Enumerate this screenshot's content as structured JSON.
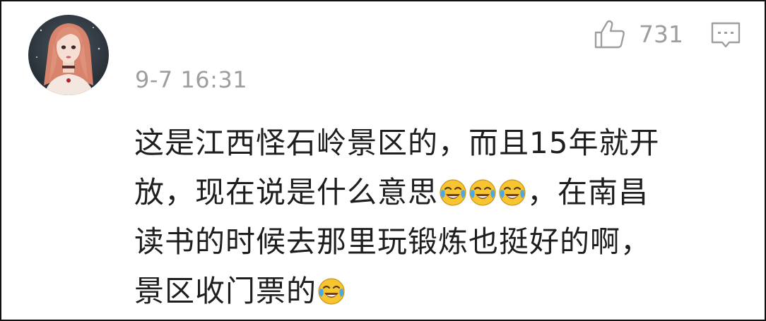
{
  "comment": {
    "timestamp": "9-7 16:31",
    "like_count": "731",
    "lines": [
      [
        "这是江西怪石岭景区的，而且15年就开"
      ],
      [
        "放，现在说是什么意思",
        "[emoji]",
        "[emoji]",
        "[emoji]",
        "，在南昌"
      ],
      [
        "读书的时候去那里玩锻炼也挺好的啊，"
      ],
      [
        "景区收门票的",
        "[emoji]"
      ]
    ],
    "emoji_name": "laugh-cry-emoji"
  },
  "icons": {
    "like": "thumbs-up-icon",
    "reply": "comment-bubble-icon",
    "avatar": "user-avatar"
  },
  "colors": {
    "meta_text": "#9e9e9e",
    "body_text": "#1e1e1e",
    "emoji_face": "#f7c531",
    "emoji_tears": "#4aa8e8"
  }
}
